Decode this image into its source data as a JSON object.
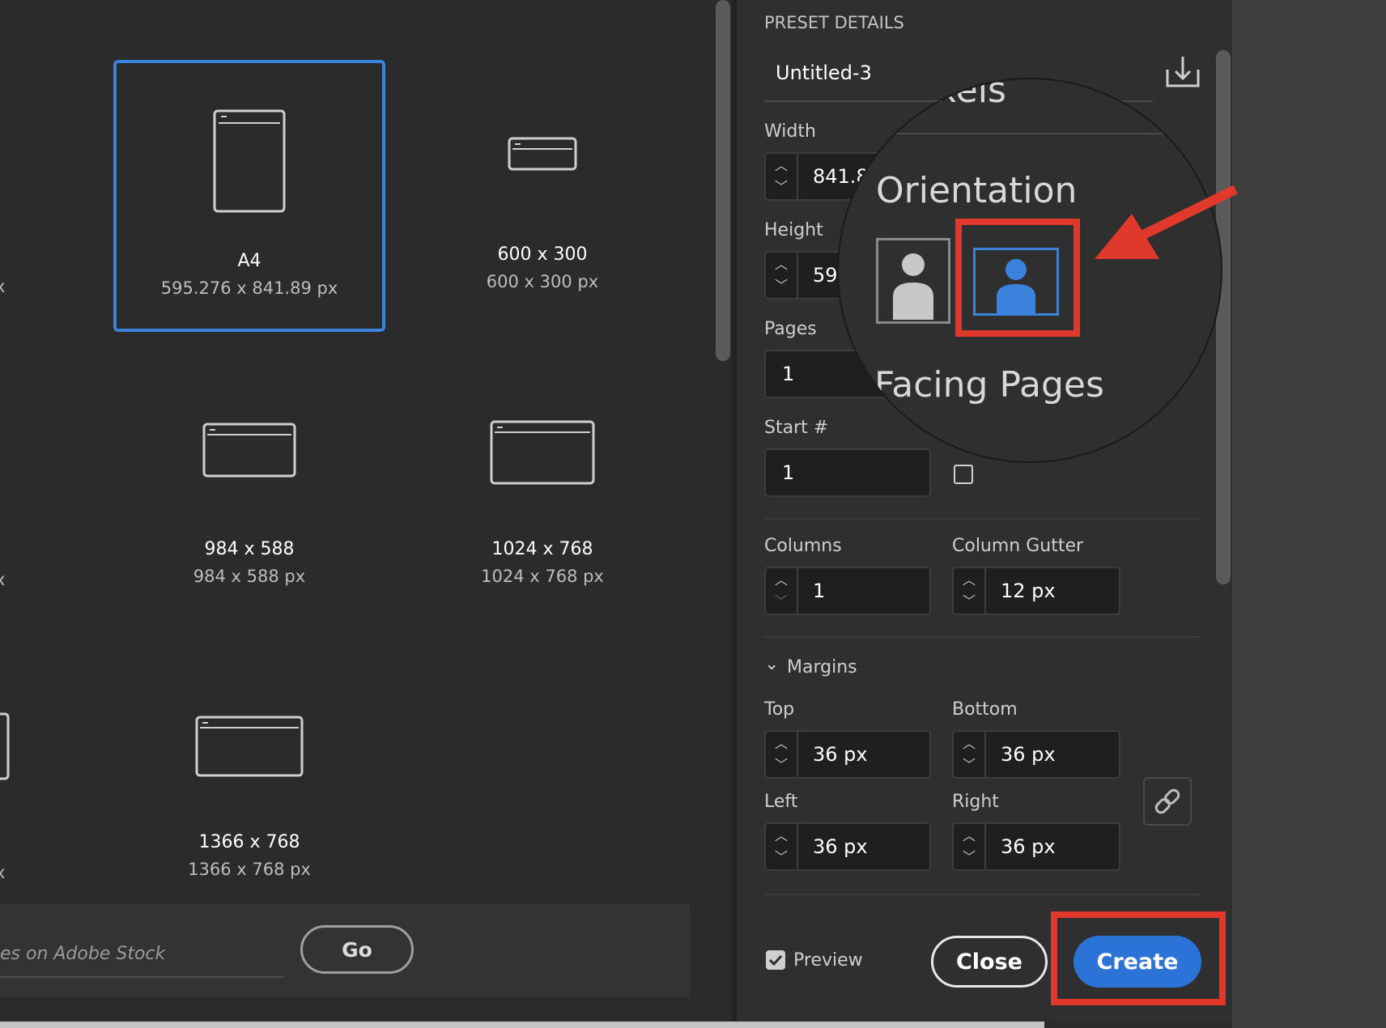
{
  "presets": [
    {
      "name": "A4",
      "size": "595.276 x 841.89 px",
      "selected": true
    },
    {
      "name": "600 x 300",
      "size": "600 x 300 px",
      "selected": false
    },
    {
      "name": "984 x 588",
      "size": "984 x 588 px",
      "selected": false
    },
    {
      "name": "1024 x 768",
      "size": "1024 x 768 px",
      "selected": false
    },
    {
      "name": "1366 x 768",
      "size": "1366 x 768 px",
      "selected": false
    }
  ],
  "left_cut_labels": [
    "x",
    "x",
    "x"
  ],
  "stock": {
    "placeholder": "es on Adobe Stock",
    "go_label": "Go"
  },
  "details": {
    "header": "PRESET DETAILS",
    "doc_name": "Untitled-3",
    "width_label": "Width",
    "width_value": "841.8",
    "height_label": "Height",
    "height_value": "59",
    "pages_label": "Pages",
    "pages_value": "1",
    "start_label": "Start #",
    "start_value": "1",
    "columns_label": "Columns",
    "columns_value": "1",
    "gutter_label": "Column Gutter",
    "gutter_value": "12 px",
    "margins_label": "Margins",
    "top_label": "Top",
    "top_value": "36 px",
    "bottom_label": "Bottom",
    "bottom_value": "36 px",
    "left_label": "Left",
    "left_value": "36 px",
    "right_label": "Right",
    "right_value": "36 px",
    "preview_label": "Preview",
    "preview_checked": true,
    "close_label": "Close",
    "create_label": "Create"
  },
  "magnifier": {
    "top_text": "xels",
    "orientation_label": "Orientation",
    "facing_label": "Facing Pages",
    "selected_orientation": "landscape"
  },
  "colors": {
    "accent": "#2c73d8",
    "selection": "#3b82dd",
    "highlight": "#e0392b"
  }
}
